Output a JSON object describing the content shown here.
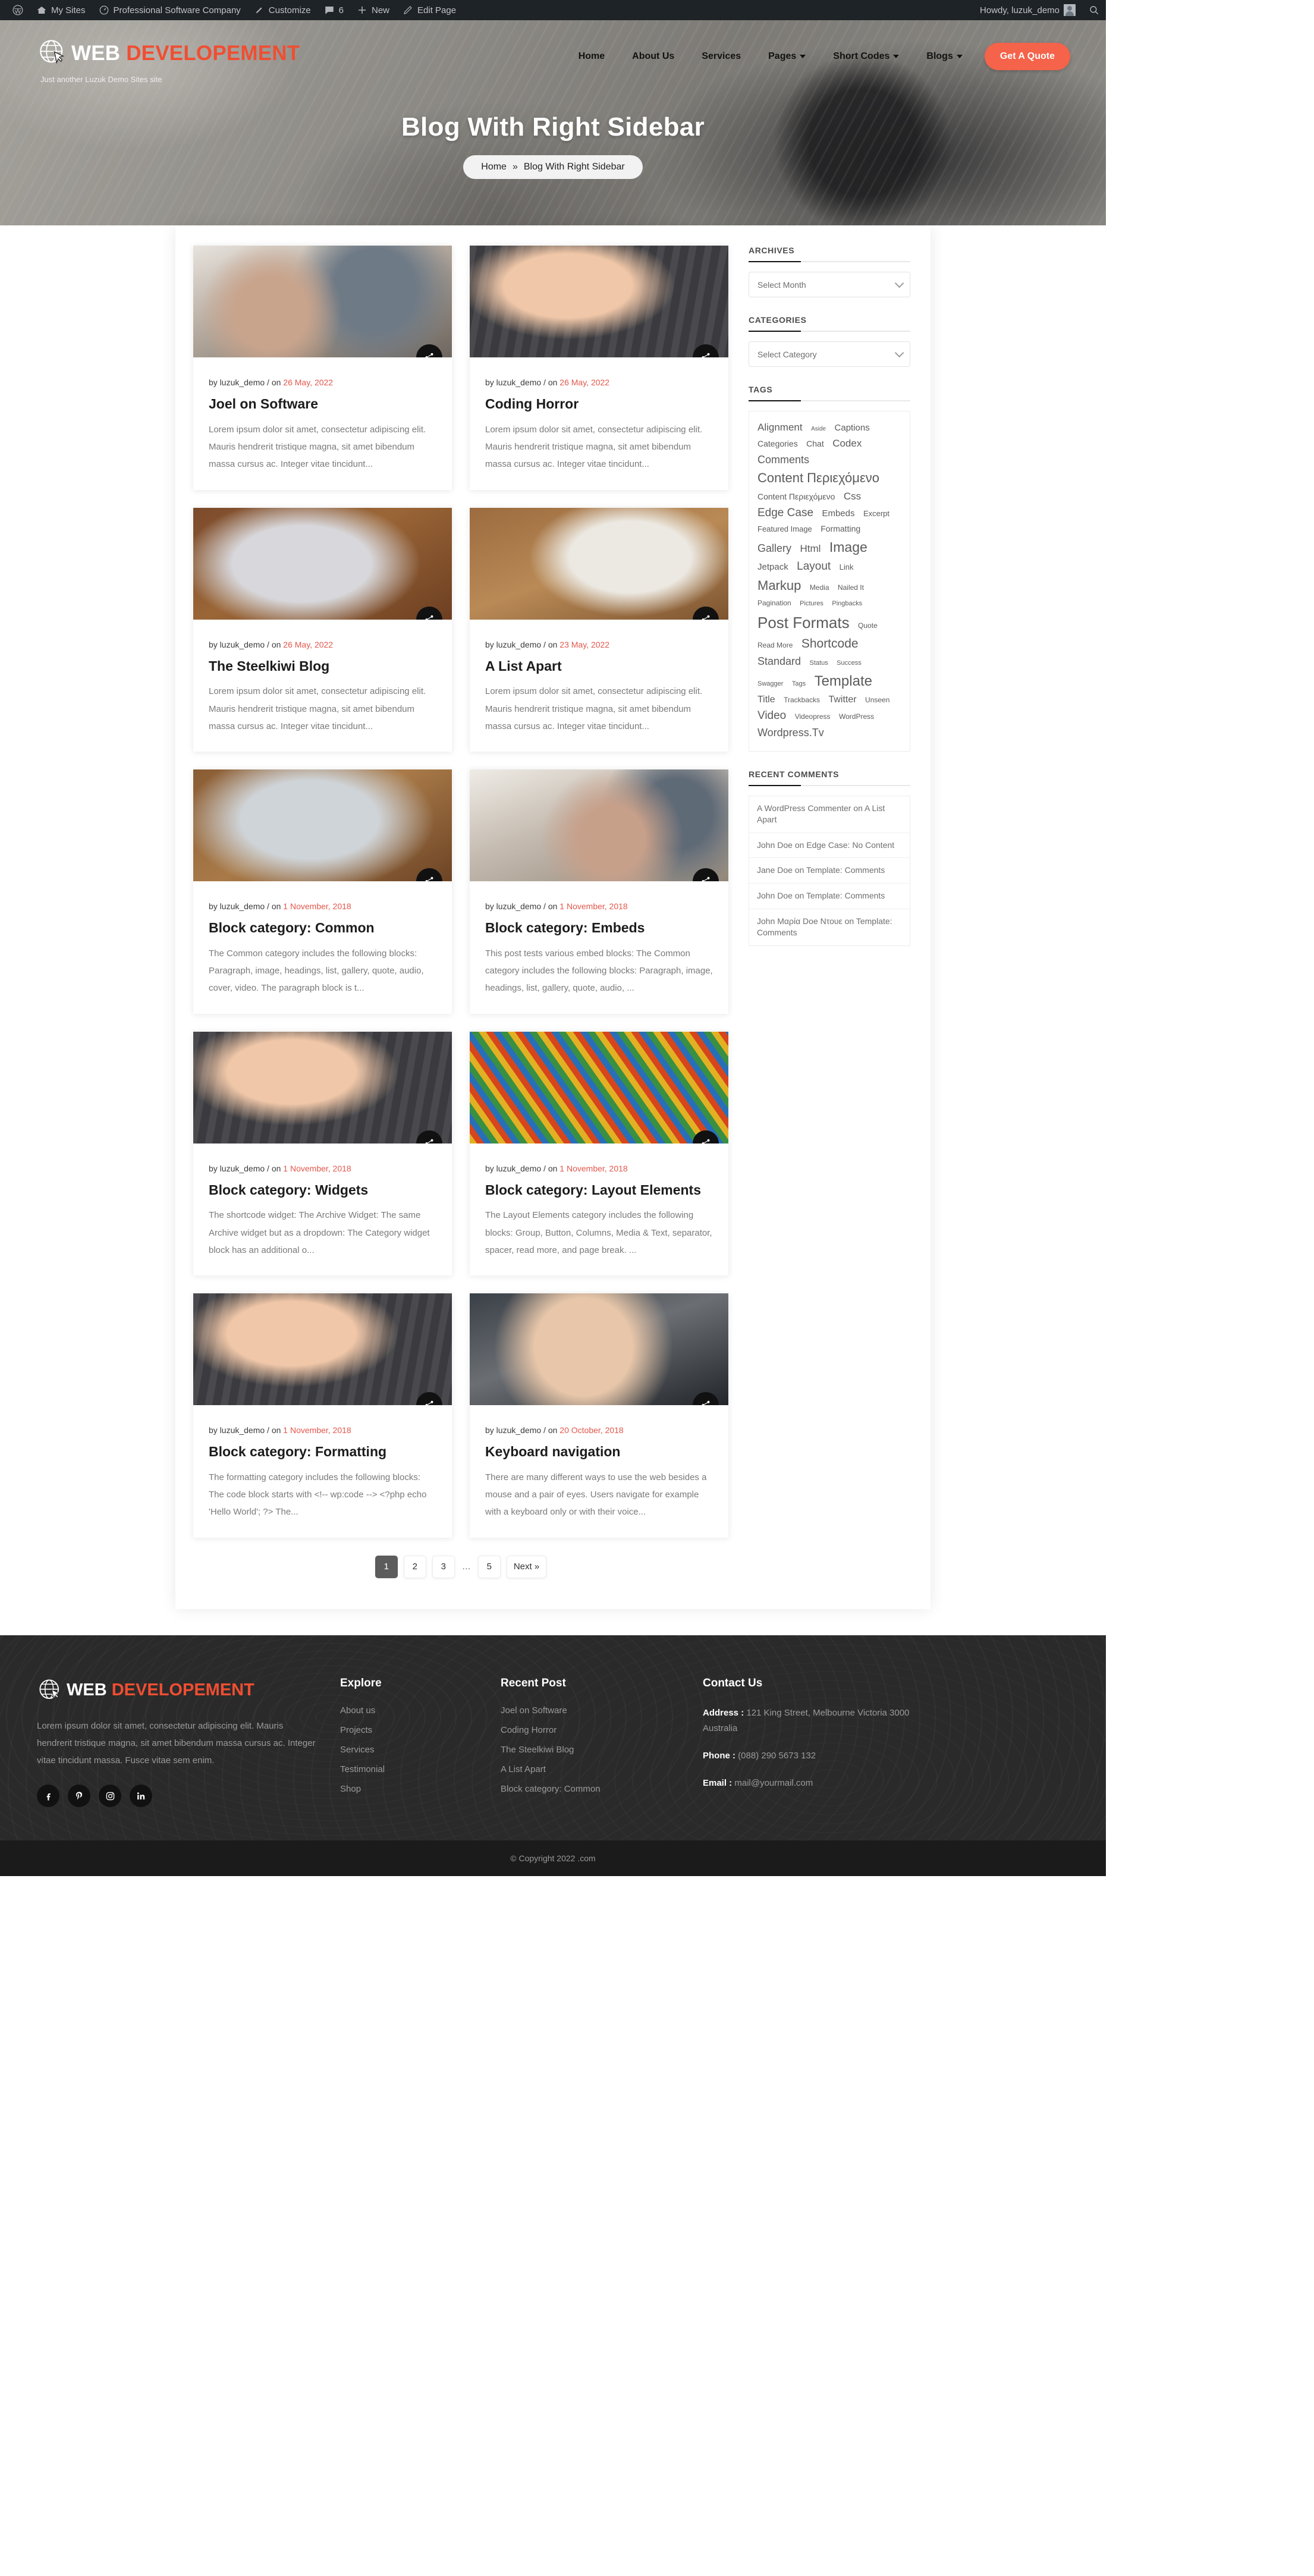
{
  "adminbar": {
    "items": [
      {
        "icon": "wordpress-icon",
        "label": ""
      },
      {
        "icon": "home-icon",
        "label": "My Sites"
      },
      {
        "icon": "dashboard-icon",
        "label": "Professional Software Company"
      },
      {
        "icon": "brush-icon",
        "label": "Customize"
      },
      {
        "icon": "comment-icon",
        "label": "6"
      },
      {
        "icon": "plus-icon",
        "label": "New"
      },
      {
        "icon": "pencil-icon",
        "label": "Edit Page"
      }
    ],
    "howdy": "Howdy, luzuk_demo",
    "search_icon": "search-icon"
  },
  "header": {
    "logo_icon": "globe-cursor-icon",
    "brand_first": "WEB",
    "brand_second": "DEVELOPEMENT",
    "tagline": "Just another Luzuk Demo Sites site",
    "nav": [
      {
        "label": "Home",
        "has_caret": false
      },
      {
        "label": "About Us",
        "has_caret": false
      },
      {
        "label": "Services",
        "has_caret": false
      },
      {
        "label": "Pages",
        "has_caret": true
      },
      {
        "label": "Short Codes",
        "has_caret": true
      },
      {
        "label": "Blogs",
        "has_caret": true
      }
    ],
    "cta": "Get A Quote"
  },
  "hero": {
    "title": "Blog With Right Sidebar",
    "crumb_home": "Home",
    "crumb_sep": "»",
    "crumb_current": "Blog With Right Sidebar"
  },
  "posts": [
    {
      "image": "img-office1",
      "author": "by luzuk_demo / on ",
      "date": "26 May, 2022",
      "title": "Joel on Software",
      "excerpt": "Lorem ipsum dolor sit amet, consectetur adipiscing elit. Mauris hendrerit tristique magna, sit amet bibendum massa cursus ac. Integer vitae tincidunt..."
    },
    {
      "image": "img-keys",
      "author": "by luzuk_demo / on ",
      "date": "26 May, 2022",
      "title": "Coding Horror",
      "excerpt": "Lorem ipsum dolor sit amet, consectetur adipiscing elit. Mauris hendrerit tristique magna, sit amet bibendum massa cursus ac. Integer vitae tincidunt..."
    },
    {
      "image": "img-laptopwood",
      "author": "by luzuk_demo / on ",
      "date": "26 May, 2022",
      "title": "The Steelkiwi Blog",
      "excerpt": "Lorem ipsum dolor sit amet, consectetur adipiscing elit. Mauris hendrerit tristique magna, sit amet bibendum massa cursus ac. Integer vitae tincidunt..."
    },
    {
      "image": "img-notebook",
      "author": "by luzuk_demo / on ",
      "date": "23 May, 2022",
      "title": "A List Apart",
      "excerpt": "Lorem ipsum dolor sit amet, consectetur adipiscing elit. Mauris hendrerit tristique magna, sit amet bibendum massa cursus ac. Integer vitae tincidunt..."
    },
    {
      "image": "img-macbook",
      "author": "by luzuk_demo / on ",
      "date": "1 November, 2018",
      "title": "Block category: Common",
      "excerpt": "The Common category includes the following blocks: Paragraph, image, headings, list, gallery, quote, audio, cover, video. The paragraph block is t..."
    },
    {
      "image": "img-office2",
      "author": "by luzuk_demo / on ",
      "date": "1 November, 2018",
      "title": "Block category: Embeds",
      "excerpt": "This post tests various embed blocks: The Common category includes the following blocks: Paragraph, image, headings, list, gallery, quote, audio, ..."
    },
    {
      "image": "img-keys",
      "author": "by luzuk_demo / on ",
      "date": "1 November, 2018",
      "title": "Block category: Widgets",
      "excerpt": "The shortcode widget: The Archive Widget: The same Archive widget but as a dropdown: The Category widget block has an additional o..."
    },
    {
      "image": "img-cables",
      "author": "by luzuk_demo / on ",
      "date": "1 November, 2018",
      "title": "Block category: Layout Elements",
      "excerpt": "The Layout Elements category includes the following blocks: Group, Button, Columns, Media & Text, separator, spacer, read more, and page break. ..."
    },
    {
      "image": "img-keys",
      "author": "by luzuk_demo / on ",
      "date": "1 November, 2018",
      "title": "Block category: Formatting",
      "excerpt": "The formatting category includes the following blocks: The code block starts with <!-- wp:code --> <?php echo 'Hello World'; ?> The..."
    },
    {
      "image": "img-woman",
      "author": "by luzuk_demo / on ",
      "date": "20 October, 2018",
      "title": "Keyboard navigation",
      "excerpt": "There are many different ways to use the web besides a mouse and a pair of eyes. Users navigate for example with a keyboard only or with their voice..."
    }
  ],
  "sidebar": {
    "archives": {
      "title": "ARCHIVES",
      "select_value": "Select Month"
    },
    "categories": {
      "title": "CATEGORIES",
      "select_value": "Select Category"
    },
    "tags": {
      "title": "TAGS",
      "items": [
        {
          "label": "Alignment",
          "size": 17
        },
        {
          "label": "Aside",
          "size": 10
        },
        {
          "label": "Captions",
          "size": 15
        },
        {
          "label": "Categories",
          "size": 14
        },
        {
          "label": "Chat",
          "size": 14
        },
        {
          "label": "Codex",
          "size": 17
        },
        {
          "label": "Comments",
          "size": 18
        },
        {
          "label": "Content Περιεχόμενο",
          "size": 22
        },
        {
          "label": "Content Περιεχόμενο",
          "size": 14
        },
        {
          "label": "Css",
          "size": 17
        },
        {
          "label": "Edge Case",
          "size": 19
        },
        {
          "label": "Embeds",
          "size": 15
        },
        {
          "label": "Excerpt",
          "size": 13
        },
        {
          "label": "Featured Image",
          "size": 13
        },
        {
          "label": "Formatting",
          "size": 14
        },
        {
          "label": "Gallery",
          "size": 18
        },
        {
          "label": "Html",
          "size": 17
        },
        {
          "label": "Image",
          "size": 23
        },
        {
          "label": "Jetpack",
          "size": 15
        },
        {
          "label": "Layout",
          "size": 19
        },
        {
          "label": "Link",
          "size": 13
        },
        {
          "label": "Markup",
          "size": 22
        },
        {
          "label": "Media",
          "size": 12
        },
        {
          "label": "Nailed It",
          "size": 12
        },
        {
          "label": "Pagination",
          "size": 12
        },
        {
          "label": "Pictures",
          "size": 11
        },
        {
          "label": "Pingbacks",
          "size": 11
        },
        {
          "label": "Post Formats",
          "size": 26
        },
        {
          "label": "Quote",
          "size": 12
        },
        {
          "label": "Read More",
          "size": 12
        },
        {
          "label": "Shortcode",
          "size": 21
        },
        {
          "label": "Standard",
          "size": 18
        },
        {
          "label": "Status",
          "size": 11
        },
        {
          "label": "Success",
          "size": 11
        },
        {
          "label": "Swagger",
          "size": 11
        },
        {
          "label": "Tags",
          "size": 11
        },
        {
          "label": "Template",
          "size": 24
        },
        {
          "label": "Title",
          "size": 16
        },
        {
          "label": "Trackbacks",
          "size": 12
        },
        {
          "label": "Twitter",
          "size": 16
        },
        {
          "label": "Unseen",
          "size": 12
        },
        {
          "label": "Video",
          "size": 19
        },
        {
          "label": "Videopress",
          "size": 12
        },
        {
          "label": "WordPress",
          "size": 12
        },
        {
          "label": "Wordpress.Tv",
          "size": 18
        }
      ]
    },
    "recent_comments": {
      "title": "RECENT COMMENTS",
      "items": [
        "A WordPress Commenter on A List Apart",
        "John Doe on Edge Case: No Content",
        "Jane Doe on Template: Comments",
        "John Doe on Template: Comments",
        "John Μαρία Doe Ντουε on Template: Comments"
      ]
    }
  },
  "pagination": {
    "pages": [
      "1",
      "2",
      "3",
      "…",
      "5"
    ],
    "active": "1",
    "next_label": "Next »"
  },
  "footer": {
    "brand_first": "WEB",
    "brand_second": "DEVELOPEMENT",
    "about": "Lorem ipsum dolor sit amet, consectetur adipiscing elit. Mauris hendrerit tristique magna, sit amet bibendum massa cursus ac. Integer vitae tincidunt massa. Fusce vitae sem enim.",
    "socials": [
      "facebook-icon",
      "pinterest-icon",
      "instagram-icon",
      "linkedin-icon"
    ],
    "explore": {
      "title": "Explore",
      "links": [
        "About us",
        "Projects",
        "Services",
        "Testimonial",
        "Shop"
      ]
    },
    "recent_post": {
      "title": "Recent Post",
      "links": [
        "Joel on Software",
        "Coding Horror",
        "The Steelkiwi Blog",
        "A List Apart",
        "Block category: Common"
      ]
    },
    "contact": {
      "title": "Contact Us",
      "address_label": "Address :",
      "address_value": " 121 King Street, Melbourne Victoria 3000 Australia",
      "phone_label": "Phone :",
      "phone_value": " (088) 290 5673 132",
      "email_label": "Email :",
      "email_value": " mail@yourmail.com"
    },
    "copyright": "© Copyright 2022 .com"
  },
  "colors": {
    "accent": "#f04e32",
    "admin_bar": "#1d2327",
    "footer_bg": "#2a2a2a",
    "copy_bg": "#1b1b1b",
    "date_red": "#e2574c"
  }
}
